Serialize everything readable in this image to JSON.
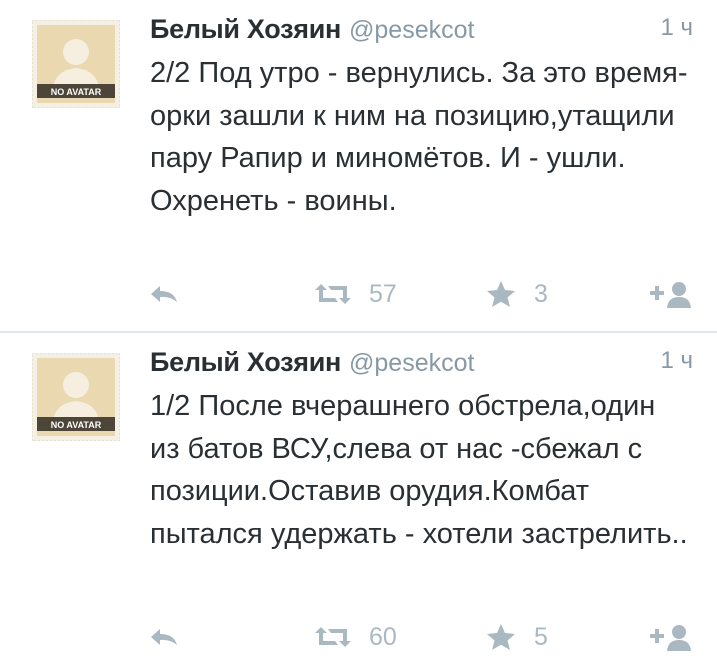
{
  "tweets": [
    {
      "author_name": "Белый Хозяин",
      "handle": "@pesekcot",
      "time": "1 ч",
      "avatar_label": "NO AVATAR",
      "text": "2/2 Под утро - вернулись. За это время- орки зашли к ним на позицию,утащили пару Рапир и миномётов. И - ушли. Охренеть - воины.",
      "retweets": "57",
      "favorites": "3"
    },
    {
      "author_name": "Белый Хозяин",
      "handle": "@pesekcot",
      "time": "1 ч",
      "avatar_label": "NO AVATAR",
      "text": "1/2 После вчерашнего обстрела,один из батов ВСУ,слева от нас -сбежал с позиции.Оставив орудия.Комбат пытался удержать - хотели застрелить..",
      "retweets": "60",
      "favorites": "5"
    }
  ],
  "icons": {
    "reply": "reply-icon",
    "retweet": "retweet-icon",
    "favorite": "star-icon",
    "follow": "add-user-icon"
  },
  "colors": {
    "text": "#292f33",
    "muted": "#8899a6",
    "icon": "#aab8c2",
    "divider": "#e1e8ed",
    "avatar_bg": "#e8d9b5"
  }
}
